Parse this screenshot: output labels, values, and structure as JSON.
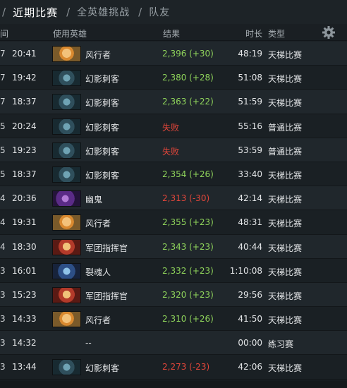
{
  "tabs": {
    "items": [
      "近期比赛",
      "全英雄挑战",
      "队友"
    ]
  },
  "columns": {
    "time": "间",
    "hero": "使用英雄",
    "result": "结果",
    "duration": "时长",
    "type": "类型"
  },
  "colors": {
    "win": "#8fd45b",
    "loss": "#e2463a"
  },
  "matches": [
    {
      "date": "7",
      "time": "20:41",
      "hero": "风行者",
      "hero_icon": "windranger",
      "result": "2,396 (+30)",
      "status": "win",
      "duration": "48:19",
      "type": "天梯比赛"
    },
    {
      "date": "7",
      "time": "19:42",
      "hero": "幻影刺客",
      "hero_icon": "phantom-assassin",
      "result": "2,380 (+28)",
      "status": "win",
      "duration": "51:08",
      "type": "天梯比赛"
    },
    {
      "date": "7",
      "time": "18:37",
      "hero": "幻影刺客",
      "hero_icon": "phantom-assassin",
      "result": "2,363 (+22)",
      "status": "win",
      "duration": "51:59",
      "type": "天梯比赛"
    },
    {
      "date": "5",
      "time": "20:24",
      "hero": "幻影刺客",
      "hero_icon": "phantom-assassin",
      "result": "失败",
      "status": "loss",
      "duration": "55:16",
      "type": "普通比赛"
    },
    {
      "date": "5",
      "time": "19:23",
      "hero": "幻影刺客",
      "hero_icon": "phantom-assassin",
      "result": "失败",
      "status": "loss",
      "duration": "53:59",
      "type": "普通比赛"
    },
    {
      "date": "5",
      "time": "18:37",
      "hero": "幻影刺客",
      "hero_icon": "phantom-assassin",
      "result": "2,354 (+26)",
      "status": "win",
      "duration": "33:40",
      "type": "天梯比赛"
    },
    {
      "date": "4",
      "time": "20:36",
      "hero": "幽鬼",
      "hero_icon": "spectre",
      "result": "2,313 (-30)",
      "status": "loss",
      "duration": "42:14",
      "type": "天梯比赛"
    },
    {
      "date": "4",
      "time": "19:31",
      "hero": "风行者",
      "hero_icon": "windranger",
      "result": "2,355 (+23)",
      "status": "win",
      "duration": "48:31",
      "type": "天梯比赛"
    },
    {
      "date": "4",
      "time": "18:30",
      "hero": "军团指挥官",
      "hero_icon": "legion-commander",
      "result": "2,343 (+23)",
      "status": "win",
      "duration": "40:44",
      "type": "天梯比赛"
    },
    {
      "date": "3",
      "time": "16:01",
      "hero": "裂魂人",
      "hero_icon": "spirit-breaker",
      "result": "2,332 (+23)",
      "status": "win",
      "duration": "1:10:08",
      "type": "天梯比赛"
    },
    {
      "date": "3",
      "time": "15:23",
      "hero": "军团指挥官",
      "hero_icon": "legion-commander",
      "result": "2,320 (+23)",
      "status": "win",
      "duration": "29:56",
      "type": "天梯比赛"
    },
    {
      "date": "3",
      "time": "14:33",
      "hero": "风行者",
      "hero_icon": "windranger",
      "result": "2,310 (+26)",
      "status": "win",
      "duration": "41:50",
      "type": "天梯比赛"
    },
    {
      "date": "3",
      "time": "14:32",
      "hero": "--",
      "hero_icon": "",
      "result": "",
      "status": "none",
      "duration": "00:00",
      "type": "练习赛"
    },
    {
      "date": "3",
      "time": "13:44",
      "hero": "幻影刺客",
      "hero_icon": "phantom-assassin",
      "result": "2,273 (-23)",
      "status": "loss",
      "duration": "42:06",
      "type": "天梯比赛"
    }
  ]
}
